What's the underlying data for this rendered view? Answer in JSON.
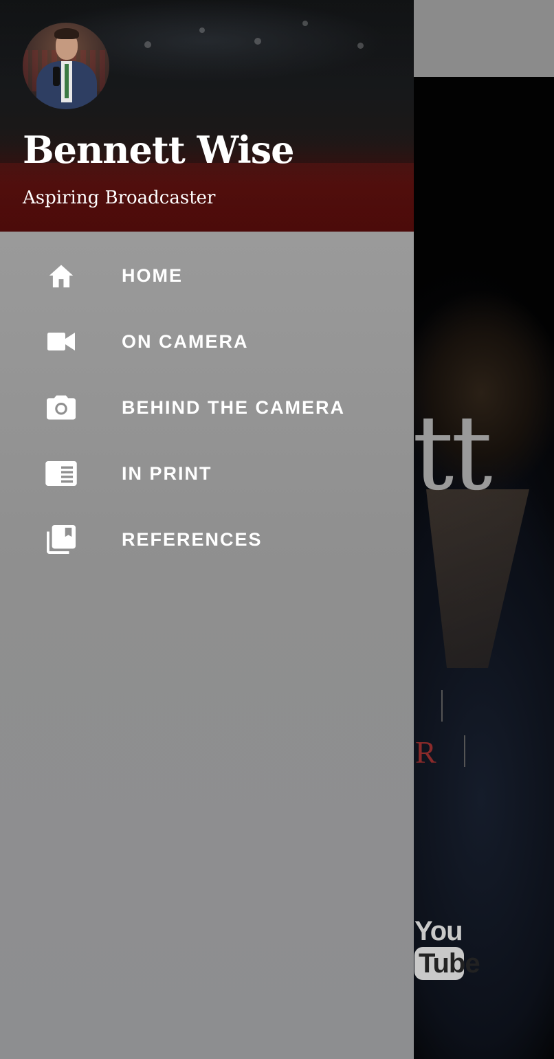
{
  "drawer": {
    "name": "Bennett Wise",
    "tagline": "Aspiring Broadcaster",
    "nav": [
      {
        "label": "HOME",
        "icon": "home-icon"
      },
      {
        "label": "ON CAMERA",
        "icon": "videocam-icon"
      },
      {
        "label": "BEHIND THE CAMERA",
        "icon": "camera-icon"
      },
      {
        "label": "IN PRINT",
        "icon": "newspaper-icon"
      },
      {
        "label": "REFERENCES",
        "icon": "library-books-icon"
      }
    ]
  },
  "background": {
    "name_fragment": "tt",
    "subtitle_fragment": "R",
    "youtube_you": "You",
    "youtube_tube": "Tube"
  },
  "colors": {
    "drawer_overlay": "#8c8d8f",
    "text": "#ffffff",
    "accent_red": "#8a2a2a"
  }
}
